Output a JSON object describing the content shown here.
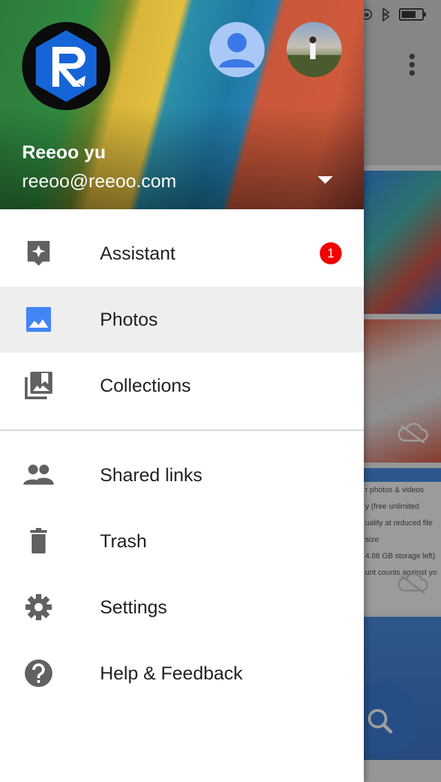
{
  "account": {
    "name": "Reeoo yu",
    "email": "reeoo@reeoo.com"
  },
  "menu": {
    "primary": [
      {
        "label": "Assistant",
        "icon": "assistant-icon",
        "badge": "1"
      },
      {
        "label": "Photos",
        "icon": "photos-icon",
        "active": true
      },
      {
        "label": "Collections",
        "icon": "collections-icon"
      }
    ],
    "secondary": [
      {
        "label": "Shared links",
        "icon": "people-icon"
      },
      {
        "label": "Trash",
        "icon": "trash-icon"
      },
      {
        "label": "Settings",
        "icon": "gear-icon"
      },
      {
        "label": "Help & Feedback",
        "icon": "help-icon"
      }
    ]
  },
  "background": {
    "tile_lines": [
      "r photos & videos",
      "y (free unlimited",
      "uality at reduced file size",
      "4.88 GB storage left)",
      "unt counts against yo"
    ]
  },
  "colors": {
    "accent": "#4285f4",
    "badge": "#f20000",
    "icon_gray": "#616161",
    "active_row": "#eeeeee"
  }
}
